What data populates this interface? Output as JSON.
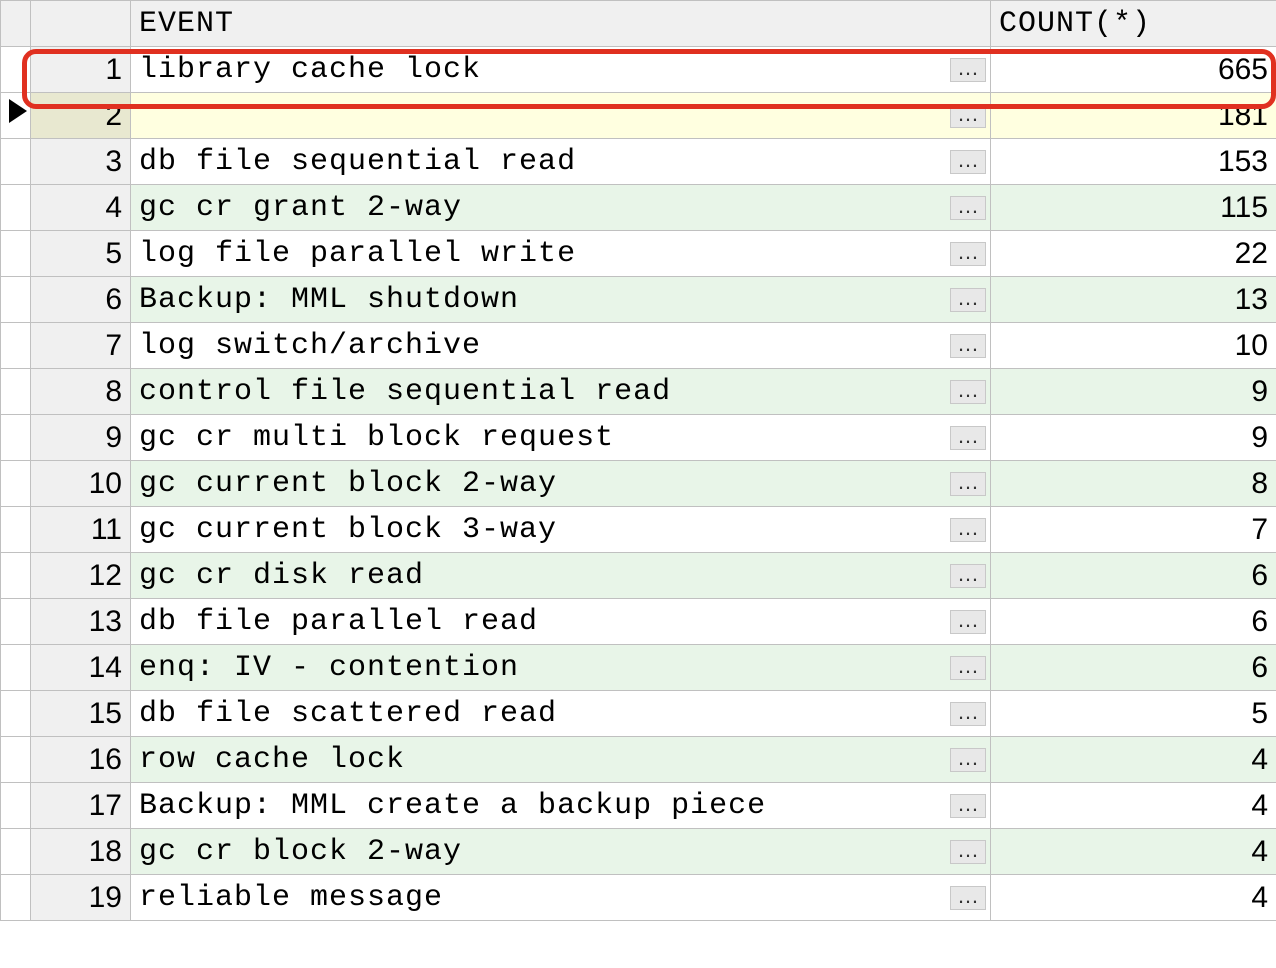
{
  "columns": {
    "event": "EVENT",
    "count": "COUNT(*)"
  },
  "rows": [
    {
      "n": "1",
      "event": "library cache lock",
      "count": "665",
      "style": "odd",
      "highlighted": true
    },
    {
      "n": "2",
      "event": "",
      "count": "181",
      "style": "hl",
      "current": true
    },
    {
      "n": "3",
      "event": "db file sequential read",
      "count": "153",
      "style": "odd"
    },
    {
      "n": "4",
      "event": "gc cr grant 2-way",
      "count": "115",
      "style": "even"
    },
    {
      "n": "5",
      "event": "log file parallel write",
      "count": "22",
      "style": "odd"
    },
    {
      "n": "6",
      "event": "Backup: MML shutdown",
      "count": "13",
      "style": "even"
    },
    {
      "n": "7",
      "event": "log switch/archive",
      "count": "10",
      "style": "odd"
    },
    {
      "n": "8",
      "event": "control file sequential read",
      "count": "9",
      "style": "even"
    },
    {
      "n": "9",
      "event": "gc cr multi block request",
      "count": "9",
      "style": "odd"
    },
    {
      "n": "10",
      "event": "gc current block 2-way",
      "count": "8",
      "style": "even"
    },
    {
      "n": "11",
      "event": "gc current block 3-way",
      "count": "7",
      "style": "odd"
    },
    {
      "n": "12",
      "event": "gc cr disk read",
      "count": "6",
      "style": "even"
    },
    {
      "n": "13",
      "event": "db file parallel read",
      "count": "6",
      "style": "odd"
    },
    {
      "n": "14",
      "event": "enq: IV -  contention",
      "count": "6",
      "style": "even"
    },
    {
      "n": "15",
      "event": "db file scattered read",
      "count": "5",
      "style": "odd"
    },
    {
      "n": "16",
      "event": "row cache lock",
      "count": "4",
      "style": "even"
    },
    {
      "n": "17",
      "event": "Backup: MML create a backup piece",
      "count": "4",
      "style": "odd"
    },
    {
      "n": "18",
      "event": "gc cr block 2-way",
      "count": "4",
      "style": "even"
    },
    {
      "n": "19",
      "event": "reliable message",
      "count": "4",
      "style": "odd"
    }
  ],
  "ellipsis_label": "…"
}
